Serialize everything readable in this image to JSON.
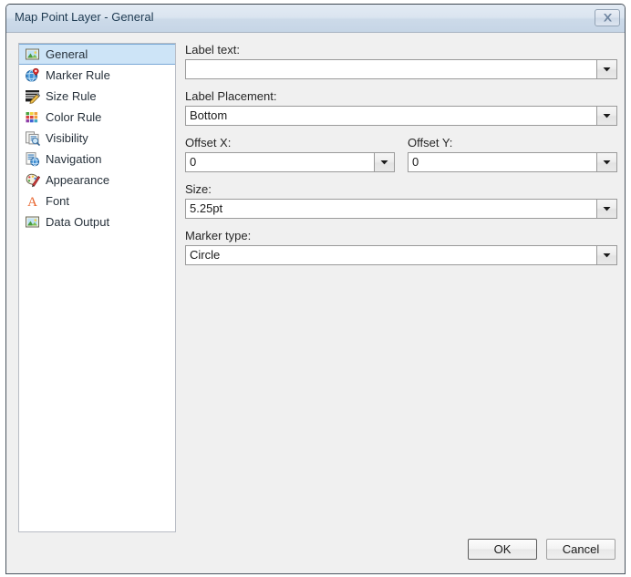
{
  "window": {
    "title": "Map Point Layer - General",
    "close_icon": "close-x-icon"
  },
  "sidebar": {
    "items": [
      {
        "label": "General",
        "icon": "image-picture-icon",
        "selected": true
      },
      {
        "label": "Marker Rule",
        "icon": "globe-pin-icon",
        "selected": false
      },
      {
        "label": "Size Rule",
        "icon": "lines-pencil-icon",
        "selected": false
      },
      {
        "label": "Color Rule",
        "icon": "color-swatches-icon",
        "selected": false
      },
      {
        "label": "Visibility",
        "icon": "document-search-icon",
        "selected": false
      },
      {
        "label": "Navigation",
        "icon": "document-globe-icon",
        "selected": false
      },
      {
        "label": "Appearance",
        "icon": "paint-palette-icon",
        "selected": false
      },
      {
        "label": "Font",
        "icon": "font-letter-a-icon",
        "selected": false
      },
      {
        "label": "Data Output",
        "icon": "image-picture-icon",
        "selected": false
      }
    ]
  },
  "form": {
    "label_text": {
      "label": "Label text:",
      "value": "",
      "placeholder": ""
    },
    "label_placement": {
      "label": "Label Placement:",
      "value": "Bottom"
    },
    "offset_x": {
      "label": "Offset X:",
      "value": "0"
    },
    "offset_y": {
      "label": "Offset Y:",
      "value": "0"
    },
    "size": {
      "label": "Size:",
      "value": "5.25pt"
    },
    "marker_type": {
      "label": "Marker type:",
      "value": "Circle"
    }
  },
  "footer": {
    "ok_label": "OK",
    "cancel_label": "Cancel"
  },
  "colors": {
    "dialog_background": "#f0f0f0",
    "titlebar_top": "#e3ebf4",
    "titlebar_bottom": "#c6d5e6",
    "title_text": "#1f3b52",
    "selection": "#cde4f7",
    "selection_border": "#7aa9d6",
    "field_border": "#9a9a9a"
  }
}
